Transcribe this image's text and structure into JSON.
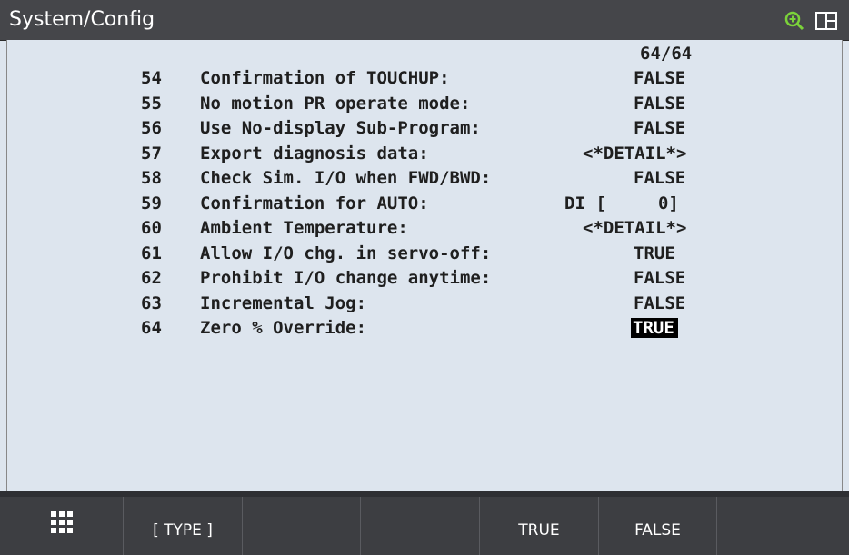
{
  "header": {
    "title": "System/Config",
    "icons": [
      "zoom-icon",
      "layout-icon"
    ]
  },
  "page_indicator": "64/64",
  "items": [
    {
      "num": "54",
      "label": "Confirmation of TOUCHUP:",
      "value": "FALSE"
    },
    {
      "num": "55",
      "label": "No motion PR operate mode:",
      "value": "FALSE"
    },
    {
      "num": "56",
      "label": "Use No-display Sub-Program:",
      "value": "FALSE"
    },
    {
      "num": "57",
      "label": "Export diagnosis data:",
      "value": "<*DETAIL*>"
    },
    {
      "num": "58",
      "label": "Check Sim. I/O when FWD/BWD:",
      "value": "FALSE"
    },
    {
      "num": "59",
      "label": "Confirmation for AUTO:",
      "value": "DI [     0]"
    },
    {
      "num": "60",
      "label": "Ambient Temperature:",
      "value": "<*DETAIL*>"
    },
    {
      "num": "61",
      "label": "Allow I/O chg. in servo-off:",
      "value": "TRUE"
    },
    {
      "num": "62",
      "label": "Prohibit I/O change anytime:",
      "value": "FALSE"
    },
    {
      "num": "63",
      "label": "Incremental Jog:",
      "value": "FALSE"
    },
    {
      "num": "64",
      "label": "Zero % Override:",
      "value": "TRUE"
    }
  ],
  "softkeys": [
    "",
    "[ TYPE ]",
    "",
    "",
    "TRUE",
    "FALSE",
    ""
  ],
  "colors": {
    "title_bar": "#45464a",
    "background": "#dde5ee",
    "selection": "#000000",
    "softkey_bar": "#3d3e42"
  }
}
